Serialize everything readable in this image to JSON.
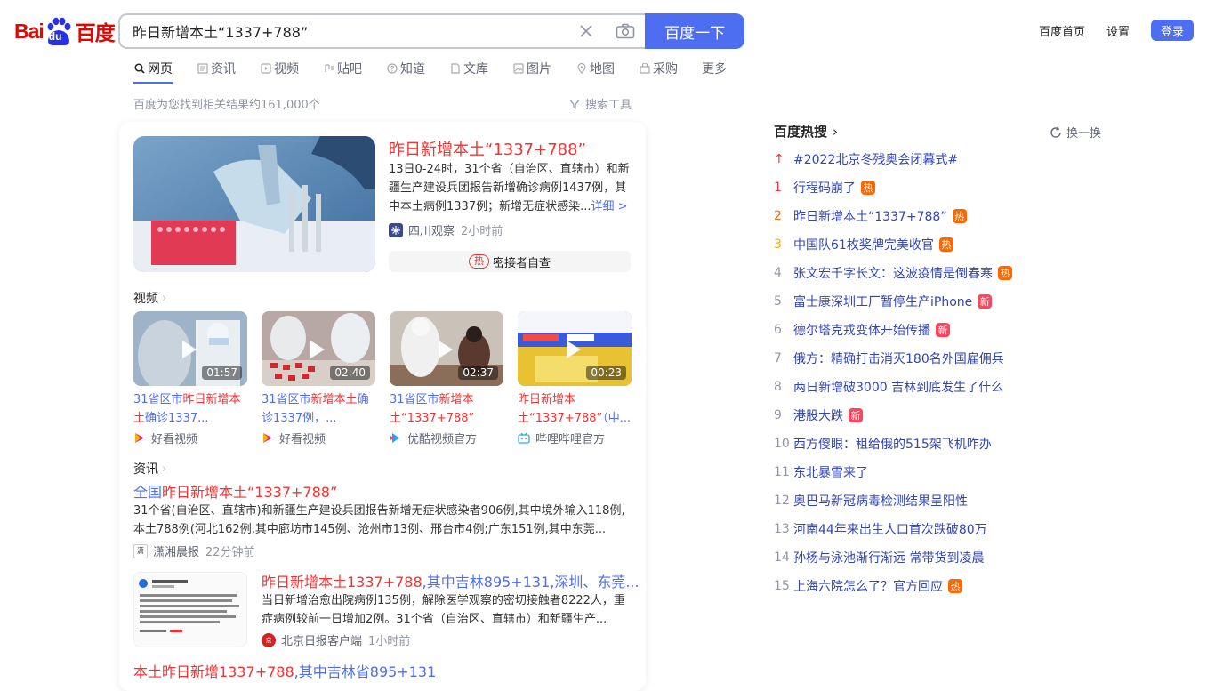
{
  "logo": {
    "part1": "Bai",
    "part2": "du",
    "part3": "百度"
  },
  "search": {
    "query": "昨日新增本土“1337+788”",
    "button": "百度一下"
  },
  "top_links": {
    "home": "百度首页",
    "settings": "设置",
    "login": "登录"
  },
  "tabs": [
    {
      "label": "网页",
      "icon": "search-icon"
    },
    {
      "label": "资讯",
      "icon": "news-icon"
    },
    {
      "label": "视频",
      "icon": "video-icon"
    },
    {
      "label": "贴吧",
      "icon": "tieba-icon"
    },
    {
      "label": "知道",
      "icon": "question-icon"
    },
    {
      "label": "文库",
      "icon": "document-icon"
    },
    {
      "label": "图片",
      "icon": "image-icon"
    },
    {
      "label": "地图",
      "icon": "map-icon"
    },
    {
      "label": "采购",
      "icon": "shop-icon"
    },
    {
      "label": "更多",
      "icon": ""
    }
  ],
  "result_count": "百度为您找到相关结果约161,000个",
  "search_tools": "搜索工具",
  "top_result": {
    "title": "昨日新增本土“1337+788”",
    "abstract": "13日0-24时，31个省（自治区、直辖市）和新疆生产建设兵团报告新增确诊病例1437例，其中本土病例1337例；新增无症状感染...",
    "more": "详细 >",
    "source": "四川观察",
    "time": "2小时前",
    "hot_tag": "热",
    "hot_text": "密接者自查"
  },
  "video_section": {
    "label": "视频",
    "videos": [
      {
        "title_a": "31省区市",
        "title_hl": "昨日新增本土",
        "title_b": "确诊1337...",
        "duration": "01:57",
        "source": "好看视频"
      },
      {
        "title_a": "31省区市",
        "title_hl": "新增本土",
        "title_b": "确诊1337例，...",
        "duration": "02:40",
        "source": "好看视频"
      },
      {
        "title_a": "31省区市",
        "title_hl": "新增本土“1337+788”",
        "title_b": "",
        "duration": "02:37",
        "source": "优酷视频官方"
      },
      {
        "title_a": "",
        "title_hl": "昨日新增本土“1337+788”",
        "title_b": "（中...",
        "duration": "00:23",
        "source": "哔哩哔哩官方"
      }
    ]
  },
  "news_section": {
    "label": "资讯",
    "item1": {
      "title_a": "全国",
      "title_hl": "昨日新增本土“1337+788”",
      "abstract": "31个省(自治区、直辖市)和新疆生产建设兵团报告新增无症状感染者906例,其中境外输入118例,本土788例(河北162例,其中廊坊市145例、沧州市13例、邢台市4例;广东151例,其中东莞...",
      "source": "潇湘晨报",
      "time": "22分钟前"
    },
    "item2": {
      "title_hl": "昨日新增本土1337+788",
      "title_b": ",其中吉林895+131,深圳、东莞...",
      "abstract": "当日新增治愈出院病例135例，解除医学观察的密切接触者8222人，重症病例较前一日增加2例。31个省（自治区、直辖市）和新疆生产...",
      "source": "北京日报客户端",
      "time": "1小时前"
    },
    "item3": {
      "title_hl": "本土昨日新增1337+788",
      "title_b": ",其中吉林省895+131"
    }
  },
  "hot_list": {
    "title": "百度热搜",
    "refresh": "换一换",
    "items": [
      {
        "rank": "↑",
        "text": "#2022北京冬残奥会闭幕式#",
        "badge": ""
      },
      {
        "rank": "1",
        "text": "行程码崩了",
        "badge": "热"
      },
      {
        "rank": "2",
        "text": "昨日新增本土“1337+788”",
        "badge": "热"
      },
      {
        "rank": "3",
        "text": "中国队61枚奖牌完美收官",
        "badge": "热"
      },
      {
        "rank": "4",
        "text": "张文宏千字长文：这波疫情是倒春寒",
        "badge": "热"
      },
      {
        "rank": "5",
        "text": "富士康深圳工厂暂停生产iPhone",
        "badge": "新"
      },
      {
        "rank": "6",
        "text": "德尔塔克戎变体开始传播",
        "badge": "新"
      },
      {
        "rank": "7",
        "text": "俄方：精确打击消灭180名外国雇佣兵",
        "badge": ""
      },
      {
        "rank": "8",
        "text": "两日新增破3000 吉林到底发生了什么",
        "badge": ""
      },
      {
        "rank": "9",
        "text": "港股大跌",
        "badge": "新"
      },
      {
        "rank": "10",
        "text": "西方傻眼：租给俄的515架飞机咋办",
        "badge": ""
      },
      {
        "rank": "11",
        "text": "东北暴雪来了",
        "badge": ""
      },
      {
        "rank": "12",
        "text": "奥巴马新冠病毒检测结果呈阳性",
        "badge": ""
      },
      {
        "rank": "13",
        "text": "河南44年来出生人口首次跌破80万",
        "badge": ""
      },
      {
        "rank": "14",
        "text": "孙杨与泳池渐行渐远 常带货到凌晨",
        "badge": ""
      },
      {
        "rank": "15",
        "text": "上海六院怎么了？官方回应",
        "badge": "热"
      }
    ]
  }
}
